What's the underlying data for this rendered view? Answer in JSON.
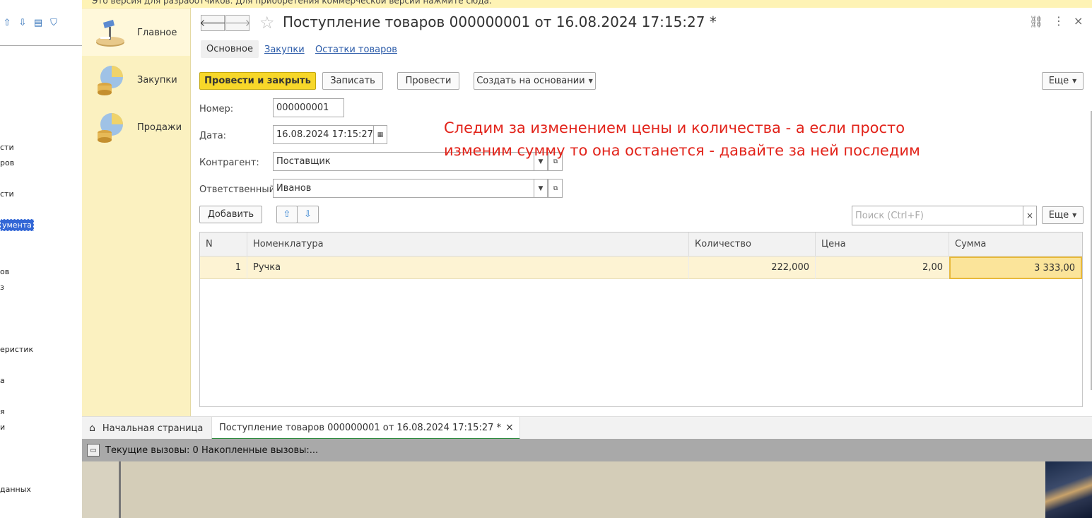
{
  "top_strip": {
    "text": "Это версия для разработчиков. Для приобретения коммерческой версии нажмите сюда."
  },
  "left_panel": {
    "tree_items": [
      {
        "label": "сти"
      },
      {
        "label": "ров"
      },
      {
        "label": "сти"
      },
      {
        "label": "умента"
      },
      {
        "label": "ов"
      },
      {
        "label": "з"
      },
      {
        "label": "еристик"
      },
      {
        "label": "а"
      },
      {
        "label": "я"
      },
      {
        "label": "и"
      },
      {
        "label": "данных"
      }
    ]
  },
  "sidebar": {
    "sections": [
      {
        "label": "Главное"
      },
      {
        "label": "Закупки"
      },
      {
        "label": "Продажи"
      }
    ]
  },
  "form": {
    "title": "Поступление товаров 000000001 от 16.08.2024 17:15:27 *",
    "tabs": [
      {
        "label": "Основное"
      },
      {
        "label": "Закупки"
      },
      {
        "label": "Остатки товаров"
      }
    ],
    "commands": {
      "post_close": "Провести и закрыть",
      "write": "Записать",
      "post": "Провести",
      "create_based": "Создать на основании",
      "more": "Еще"
    },
    "fields": {
      "number_label": "Номер:",
      "number_value": "000000001",
      "date_label": "Дата:",
      "date_value": "16.08.2024 17:15:27",
      "contractor_label": "Контрагент:",
      "contractor_value": "Поставщик",
      "responsible_label": "Ответственный:",
      "responsible_value": "Иванов"
    },
    "table_commands": {
      "add": "Добавить",
      "search_placeholder": "Поиск (Ctrl+F)",
      "more": "Еще"
    },
    "table": {
      "columns": [
        "N",
        "Номенклатура",
        "Количество",
        "Цена",
        "Сумма"
      ],
      "rows": [
        {
          "n": "1",
          "item": "Ручка",
          "qty": "222,000",
          "price": "2,00",
          "sum": "3 333,00"
        }
      ]
    }
  },
  "annotation": {
    "line1": "Следим за изменением цены и количества - а если просто",
    "line2": "изменим сумму то она останется - давайте за ней последим"
  },
  "window_tabs": [
    {
      "label": "Начальная страница"
    },
    {
      "label": "Поступление товаров 000000001 от 16.08.2024 17:15:27 *"
    }
  ],
  "status_bar": {
    "text": "Текущие вызовы: 0   Накопленные вызовы:..."
  },
  "colors": {
    "accent_yellow": "#f7d729",
    "sidebar_bg": "#fbf1c0",
    "annotation_red": "#e2231a",
    "active_tab_underline": "#2d8a3e"
  }
}
